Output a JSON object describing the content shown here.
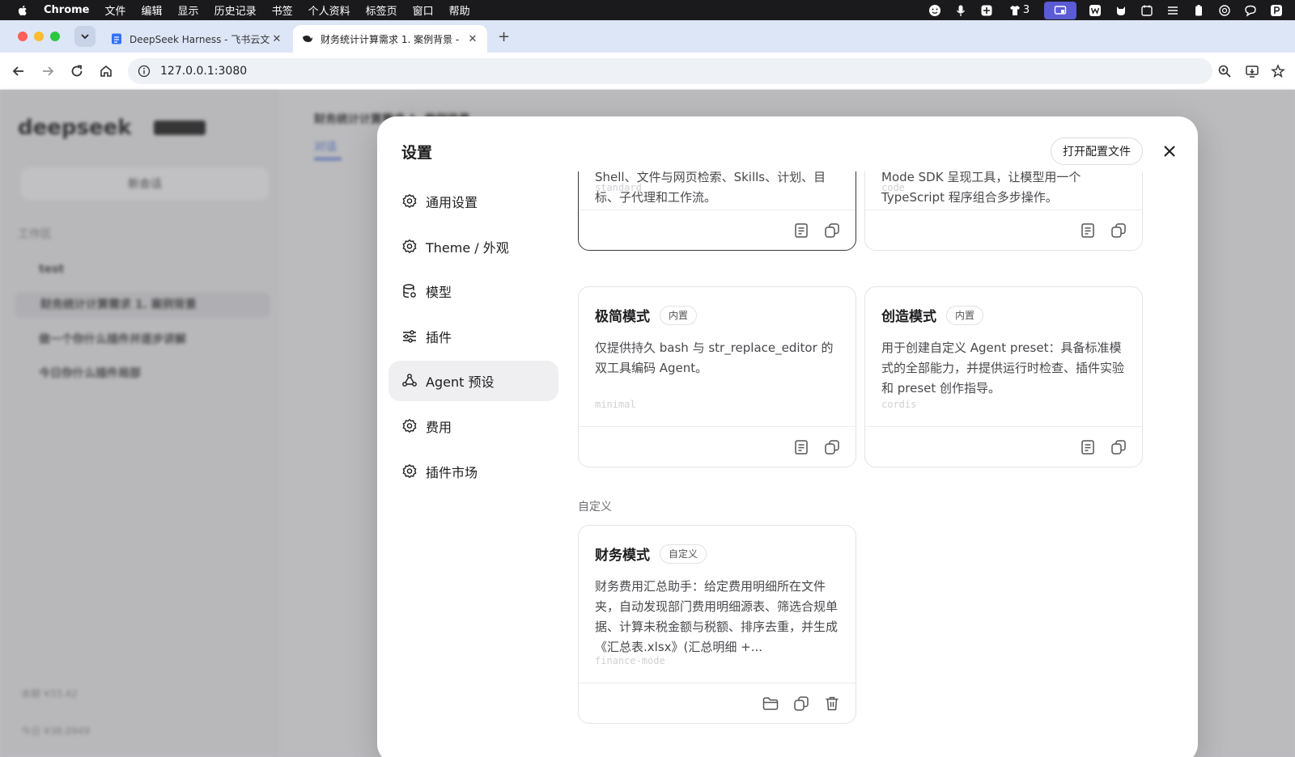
{
  "menubar": {
    "app_name": "Chrome",
    "items": [
      "文件",
      "编辑",
      "显示",
      "历史记录",
      "书签",
      "个人资料",
      "标签页",
      "窗口",
      "帮助"
    ],
    "status_count": "3"
  },
  "browser": {
    "tabs": [
      {
        "title": "DeepSeek Harness - 飞书云文",
        "active": false
      },
      {
        "title": "财务统计计算需求 1. 案例背景 -",
        "active": true
      }
    ],
    "url": "127.0.0.1:3080"
  },
  "background": {
    "logo": "deepseek",
    "new_chat": "新会话",
    "workspace_label": "工作区",
    "folder": "test",
    "conversations": [
      "财务统计计算需求 1. 案例背景",
      "做一个你什么插件并逐步讲解",
      "今日你什么插件局部"
    ],
    "main_title": "财务统计计算需求 1. 案例背景",
    "main_tab": "对话",
    "footer": [
      "本期 ¥33.42",
      "今日 ¥38.0949"
    ]
  },
  "settings": {
    "title": "设置",
    "open_config_label": "打开配置文件",
    "nav": [
      {
        "label": "通用设置",
        "icon": "gear-icon",
        "active": false
      },
      {
        "label": "Theme / 外观",
        "icon": "gear-icon",
        "active": false
      },
      {
        "label": "模型",
        "icon": "database-icon",
        "active": false
      },
      {
        "label": "插件",
        "icon": "sliders-icon",
        "active": false
      },
      {
        "label": "Agent 预设",
        "icon": "agent-icon",
        "active": true
      },
      {
        "label": "费用",
        "icon": "gear-icon",
        "active": false
      },
      {
        "label": "插件市场",
        "icon": "gear-icon",
        "active": false
      }
    ],
    "builtin_cards": [
      {
        "name": "",
        "tag": "",
        "desc": "Shell、文件与网页检索、Skills、计划、目标、子代理和工作流。",
        "id": "standard",
        "selected": true
      },
      {
        "name": "",
        "tag": "",
        "desc": "Mode SDK 呈现工具，让模型用一个 TypeScript 程序组合多步操作。",
        "id": "code",
        "selected": false
      },
      {
        "name": "极简模式",
        "tag": "内置",
        "desc": "仅提供持久 bash 与 str_replace_editor 的双工具编码 Agent。",
        "id": "minimal",
        "selected": false
      },
      {
        "name": "创造模式",
        "tag": "内置",
        "desc": "用于创建自定义 Agent preset：具备标准模式的全部能力，并提供运行时检查、插件实验和 preset 创作指导。",
        "id": "cordis",
        "selected": false
      }
    ],
    "custom_section_label": "自定义",
    "custom_cards": [
      {
        "name": "财务模式",
        "tag": "自定义",
        "desc": "财务费用汇总助手：给定费用明细所在文件夹，自动发现部门费用明细源表、筛选合规单据、计算未税金额与税额、排序去重，并生成《汇总表.xlsx》(汇总明细 +...",
        "id": "finance-mode"
      }
    ]
  }
}
